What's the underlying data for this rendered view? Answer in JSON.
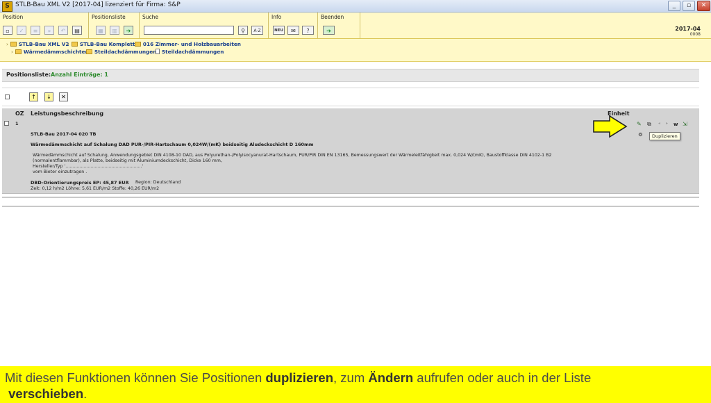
{
  "window": {
    "title": "STLB-Bau XML V2 [2017-04] lizenziert für Firma: S&P",
    "app_icon": "S",
    "controls": {
      "minimize": "_",
      "maximize": "▫",
      "close": "✕"
    }
  },
  "toolbar": {
    "groups": {
      "position": "Position",
      "positionsliste": "Positionsliste",
      "suche": "Suche",
      "info": "Info",
      "beenden": "Beenden"
    },
    "search": {
      "value": "",
      "placeholder": ""
    },
    "az_label": "A-Z",
    "neu_label": "NEU",
    "version_year": "2017-04",
    "version_num": "0008"
  },
  "breadcrumb": [
    {
      "label": "STLB-Bau XML V2",
      "icon": "folder-icon"
    },
    {
      "label": "STLB-Bau Komplett",
      "icon": "folder-icon"
    },
    {
      "label": "016 Zimmer- und Holzbauarbeiten",
      "icon": "folder-icon"
    },
    {
      "label": "Wärmedämmschichten",
      "icon": "folder-icon"
    },
    {
      "label": "Steildachdämmungen",
      "icon": "folder-icon"
    },
    {
      "label": "Steildachdämmungen",
      "icon": "document-icon"
    }
  ],
  "positionsliste": {
    "label": "Positionsliste:",
    "count_label": "Anzahl Einträge: 1"
  },
  "table": {
    "columns": {
      "oz": "OZ",
      "beschreibung": "Leistungsbeschreibung",
      "einheit": "Einheit"
    },
    "row": {
      "oz": "1",
      "code": "STLB-Bau 2017-04 020 TB",
      "short_text": "Wärmedämmschicht auf Schalung DAD PUR-/PIR-Hartschaum 0,024W/(mK) beidseitig Aludeckschicht D 160mm",
      "long_text": [
        "Wärmedämmschicht auf Schalung, Anwendungsgebiet DIN 4108-10 DAD, aus Polyurethan-/Polyisocyanurat-Hartschaum, PUR/PIR DIN EN 13165, Bemessungswert der Wärmeleitfähigkeit max. 0,024 W/(mK), Baustoffklasse DIN 4102-1 B2",
        "(normalentflammbar), als Platte, beidseitig mit Aluminiumdeckschicht, Dicke 160 mm,",
        "Hersteller/Typ '.......................................................'",
        "vom Bieter einzutragen ."
      ],
      "price_label": "DBD-Orientierungspreis EP: 45,87 EUR",
      "region_label": "Region: Deutschland",
      "details": "Zeit: 0,12 h/m2   Löhne: 5,61 EUR/m2   Stoffe: 40,26 EUR/m2"
    },
    "row_icons": {
      "move_label": "w"
    },
    "tooltip": "Duplizieren"
  },
  "callout": {
    "part1": "Mit diesen Funktionen können Sie Positionen ",
    "bold1": "duplizieren",
    "part2": ", zum ",
    "bold2": "Ändern",
    "part3": " aufrufen oder auch in der Liste",
    "bold3": "verschieben",
    "part4": "."
  },
  "colors": {
    "toolbar_bg": "#fff9c8",
    "link_blue": "#173d8e",
    "count_green": "#2d8a2d",
    "callout_yellow": "#ffff00",
    "arrow_yellow": "#ffff00"
  }
}
